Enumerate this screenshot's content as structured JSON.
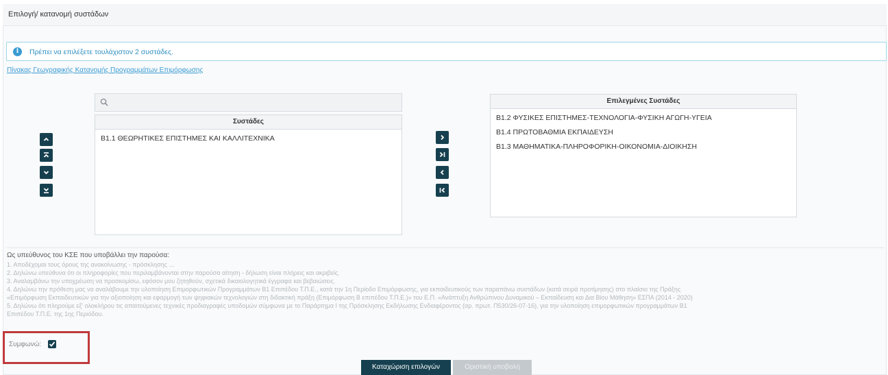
{
  "header": {
    "title": "Επιλογή/ κατανομή συστάδων"
  },
  "alert": {
    "icon": "info-icon",
    "text": "Πρέπει να επιλέξετε τουλάχιστον 2 συστάδες."
  },
  "link": {
    "text": "Πίνακας Γεωγραφικής Κατανομής Προγραμμάτων Επιμόρφωσης"
  },
  "search": {
    "value": "",
    "placeholder": "",
    "icon": "search-icon"
  },
  "left_list": {
    "header": "Συστάδες",
    "items": [
      "Β1.1 ΘΕΩΡΗΤΙΚΕΣ ΕΠΙΣΤΗΜΕΣ ΚΑΙ ΚΑΛΛΙΤΕΧΝΙΚΑ"
    ]
  },
  "right_list": {
    "header": "Επιλεγμένες Συστάδες",
    "items": [
      "Β1.2 ΦΥΣΙΚΕΣ ΕΠΙΣΤΗΜΕΣ-ΤΕΧΝΟΛΟΓΙΑ-ΦΥΣΙΚΗ ΑΓΩΓΗ-ΥΓΕΙΑ",
      "Β1.4 ΠΡΩΤΟΒΑΘΜΙΑ ΕΚΠΑΙΔΕΥΣΗ",
      "Β1.3 ΜΑΘΗΜΑΤΙΚΑ-ΠΛΗΡΟΦΟΡΙΚΗ-ΟΙΚΟΝΟΜΙΑ-ΔΙΟΙΚΗΣΗ"
    ]
  },
  "order_buttons": [
    "move-up-icon",
    "move-top-icon",
    "move-down-icon",
    "move-bottom-icon"
  ],
  "transfer_buttons": [
    "move-right-icon",
    "move-all-right-icon",
    "move-left-icon",
    "move-all-left-icon"
  ],
  "terms": {
    "title": "Ως υπεύθυνος του ΚΣΕ που υποβάλλει την παρούσα:",
    "lines": [
      "1. Αποδέχομαι τους όρους της ανακοίνωσης - πρόσκλησης ...",
      "2. Δηλώνω υπεύθυνα ότι οι πληροφορίες που περιλαμβάνονται στην παρούσα αίτηση - δήλωση είναι πλήρεις και ακριβείς.",
      "3. Αναλαμβάνω την υποχρέωση να προσκομίσω, εφόσον μου ζητηθούν, σχετικά δικαιολογητικά έγγραφα και βεβαιώσεις.",
      "4. Δηλώνω την πρόθεση μας να αναλάβουμε την υλοποίηση Επιμορφωτικών Προγραμμάτων Β1 Επιπέδου Τ.Π.Ε., κατά την 1η Περίοδο Επιμόρφωσης, για εκπαιδευτικούς των παραπάνω συστάδων (κατά σειρά προτίμησης) στο πλαίσιο της Πράξης",
      "«Επιμόρφωση Εκπαιδευτικών για την αξιοποίηση και εφαρμογή των ψηφιακών τεχνολογιών στη διδακτική πράξη (Επιμόρφωση Β επιπέδου Τ.Π.Ε.)» του Ε.Π. «Ανάπτυξη Ανθρώπινου Δυναμικού – Εκπαίδευση και Δια Βίου Μάθηση» ΕΣΠΑ (2014 - 2020)",
      "5. Δηλώνω ότι πληρούμε εξ' ολοκλήρου τις απαιτούμενες τεχνικές προδιαγραφές υποδομών σύμφωνα με το Παράρτημα Ι της Πρόσκλησης Εκδήλωσης Ενδιαφέροντος (αρ. πρωτ. Π530/26-07-16), για την υλοποίηση επιμορφωτικών προγραμμάτων Β1",
      "Επιπέδου Τ.Π.Ε. της 1ης Περιόδου."
    ]
  },
  "agree": {
    "label": "Συμφωνώ:",
    "checked": "true"
  },
  "buttons": {
    "submit": "Καταχώριση επιλογών",
    "final": "Οριστική υποβολή"
  },
  "colors": {
    "primary": "#16404f",
    "info": "#3a9bd3",
    "highlight": "#c0393b"
  }
}
